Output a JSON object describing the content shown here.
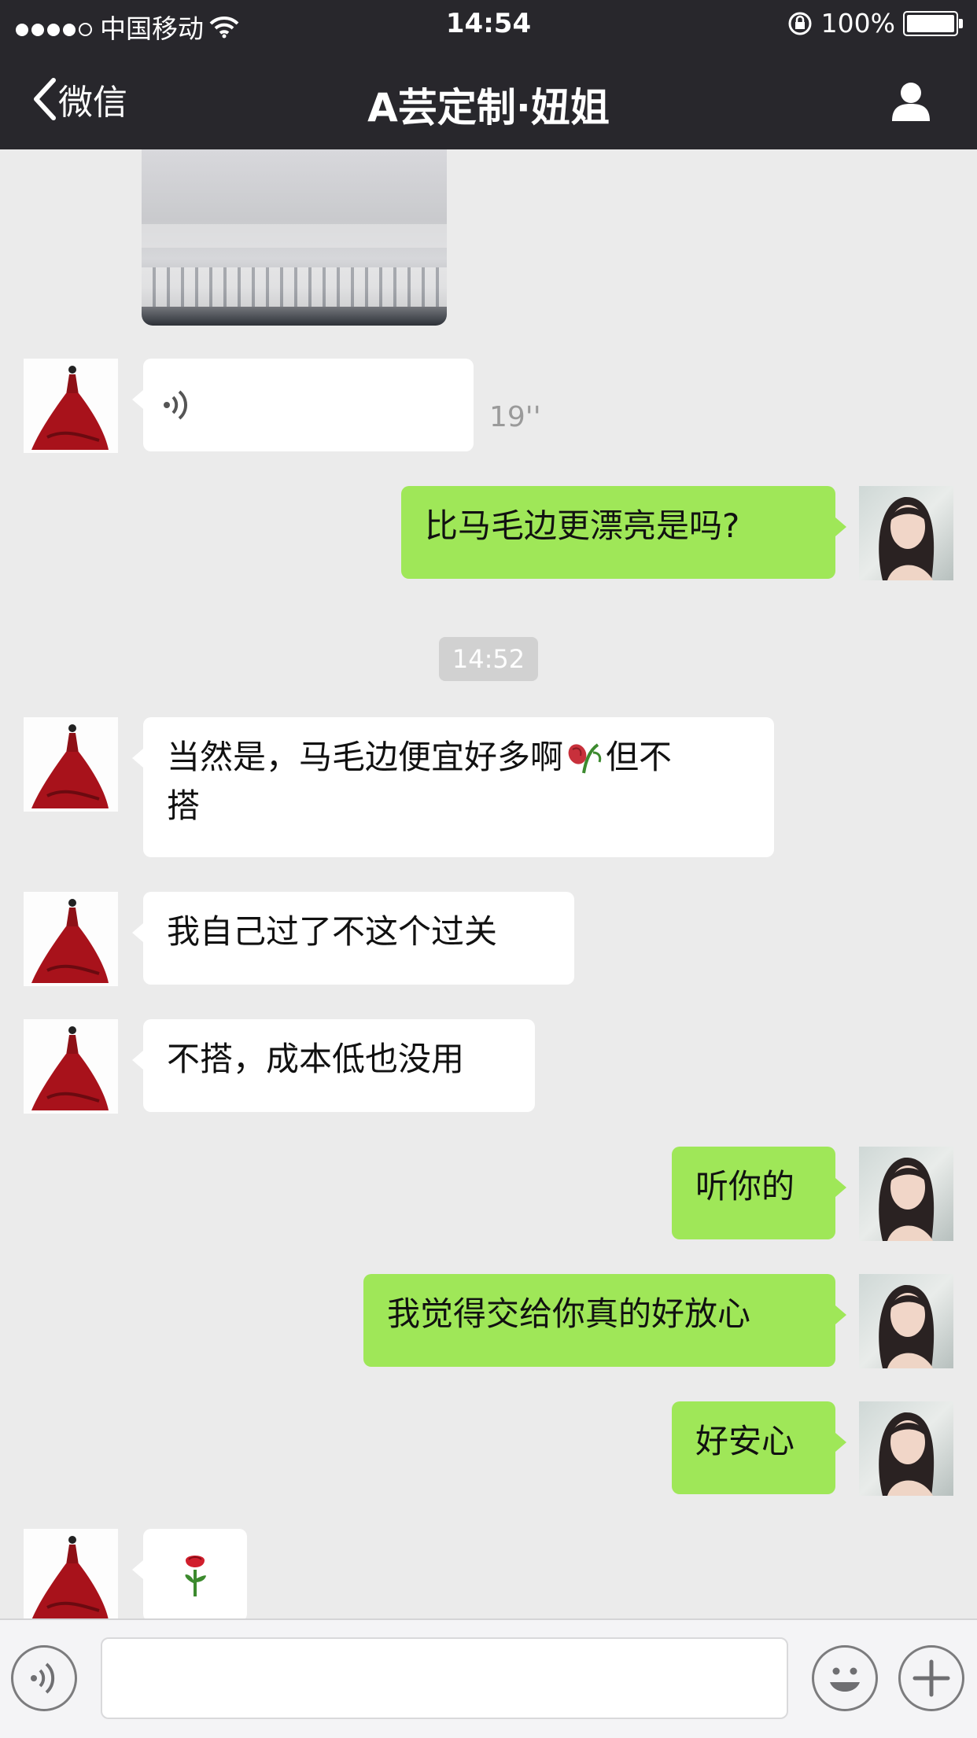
{
  "status_bar": {
    "signal_bars": 4,
    "carrier": "中国移动",
    "time": "14:54",
    "battery": "100%"
  },
  "nav": {
    "back_label": "微信",
    "title": "A芸定制·妞姐"
  },
  "messages": [
    {
      "side": "in",
      "type": "voice",
      "duration": "19''"
    },
    {
      "side": "out",
      "type": "text",
      "text": "比马毛边更漂亮是吗?"
    },
    {
      "type": "timestamp",
      "text": "14:52"
    },
    {
      "side": "in",
      "type": "text",
      "line1": "当然是，马毛边便宜好多啊",
      "line1_tail": "但不",
      "line2": "搭"
    },
    {
      "side": "in",
      "type": "text",
      "text": "我自己过了不这个过关"
    },
    {
      "side": "in",
      "type": "text",
      "text": "不搭，成本低也没用"
    },
    {
      "side": "out",
      "type": "text",
      "text": "听你的"
    },
    {
      "side": "out",
      "type": "text",
      "text": "我觉得交给你真的好放心"
    },
    {
      "side": "out",
      "type": "text",
      "text": "好安心"
    },
    {
      "side": "in",
      "type": "emoji",
      "icon": "rose-icon"
    }
  ],
  "colors": {
    "nav_bg": "#28272c",
    "chat_bg": "#ebebeb",
    "bubble_out": "#9fe758",
    "bubble_in": "#ffffff"
  },
  "icons": {
    "back": "chevron-left-icon",
    "profile": "person-icon",
    "voice": "voice-icon",
    "emoji": "smiley-icon",
    "add": "plus-icon"
  }
}
